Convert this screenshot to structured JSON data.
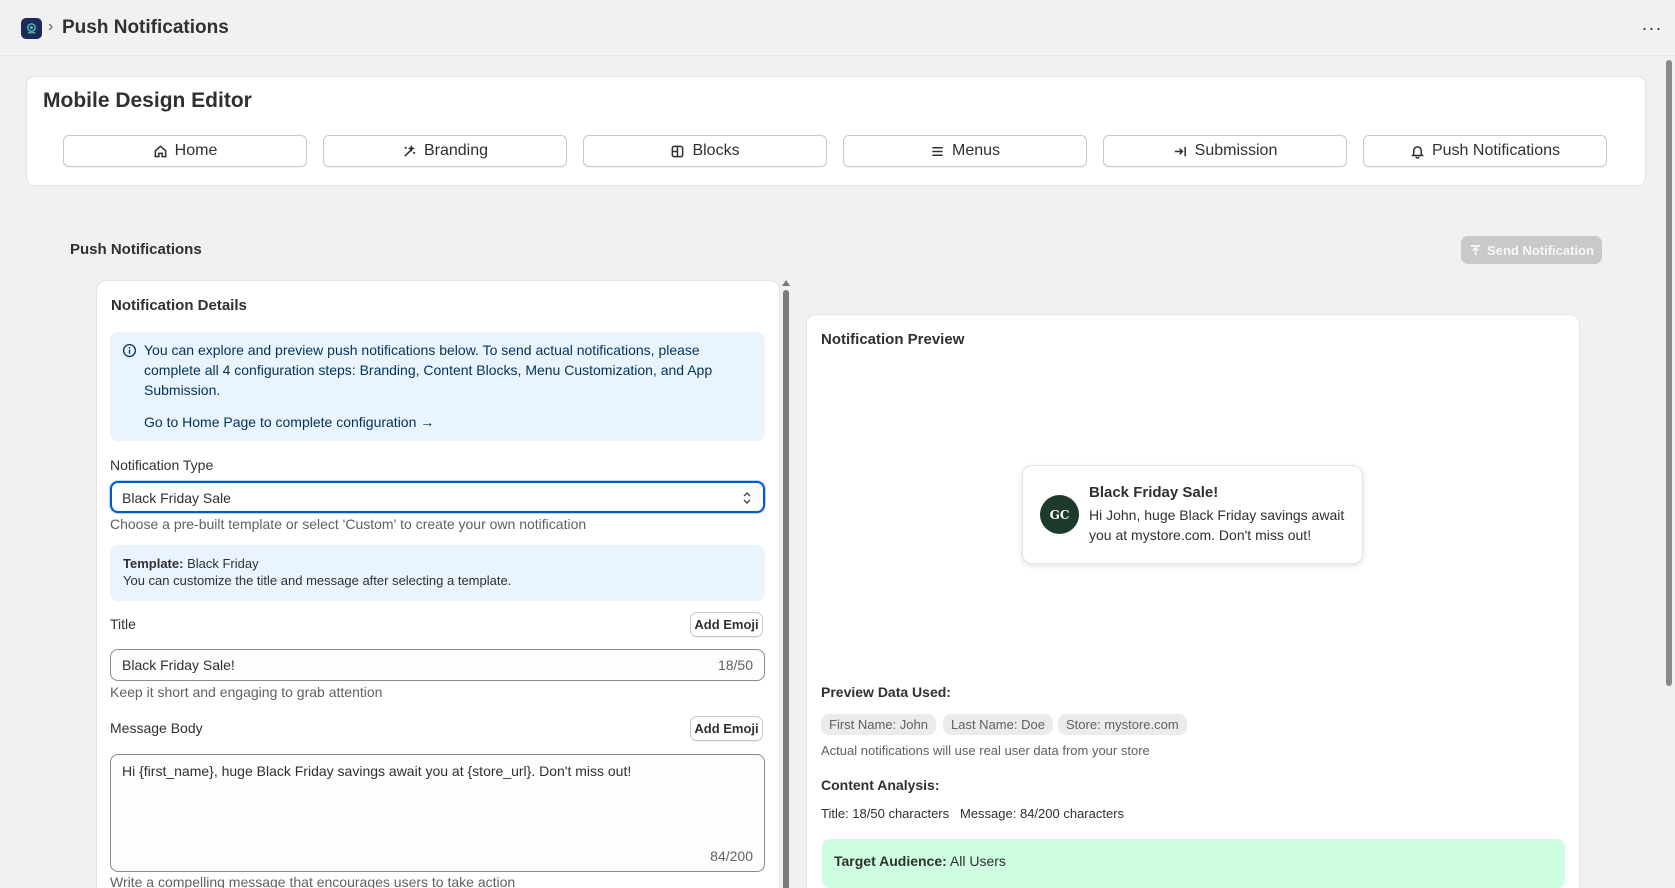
{
  "topbar": {
    "crumb_separator": "›",
    "title": "Push Notifications",
    "more_label": "···"
  },
  "editor": {
    "title": "Mobile Design Editor",
    "tabs": [
      {
        "label": "Home",
        "icon": "home-icon"
      },
      {
        "label": "Branding",
        "icon": "magic-wand-icon"
      },
      {
        "label": "Blocks",
        "icon": "blocks-icon"
      },
      {
        "label": "Menus",
        "icon": "menu-icon"
      },
      {
        "label": "Submission",
        "icon": "arrow-right-to-line-icon"
      },
      {
        "label": "Push Notifications",
        "icon": "bell-icon"
      }
    ]
  },
  "section": {
    "title": "Push Notifications",
    "send_button": "Send Notification"
  },
  "details": {
    "heading": "Notification Details",
    "info_text": "You can explore and preview push notifications below. To send actual notifications, please complete all 4 configuration steps: Branding, Content Blocks, Menu Customization, and App Submission.",
    "info_link": "Go to Home Page to complete configuration →",
    "type_label": "Notification Type",
    "type_value": "Black Friday Sale",
    "type_help": "Choose a pre-built template or select 'Custom' to create your own notification",
    "template_label": "Template:",
    "template_value": "Black Friday",
    "template_note": "You can customize the title and message after selecting a template.",
    "title_label": "Title",
    "add_emoji": "Add Emoji",
    "title_value": "Black Friday Sale!",
    "title_count": "18/50",
    "title_help": "Keep it short and engaging to grab attention",
    "message_label": "Message Body",
    "message_value": "Hi {first_name}, huge Black Friday savings await you at {store_url}. Don't miss out!",
    "message_count": "84/200",
    "message_help": "Write a compelling message that encourages users to take action"
  },
  "preview": {
    "heading": "Notification Preview",
    "avatar_text": "GC",
    "notif_title": "Black Friday Sale!",
    "notif_body": "Hi John, huge Black Friday savings await you at mystore.com. Don't miss out!",
    "data_heading": "Preview Data Used:",
    "chips": [
      "First Name: John",
      "Last Name: Doe",
      "Store: mystore.com"
    ],
    "data_note": "Actual notifications will use real user data from your store",
    "analysis_heading": "Content Analysis:",
    "analysis_title": "Title: 18/50 characters",
    "analysis_message": "Message: 84/200 characters",
    "audience_label": "Target Audience:",
    "audience_value": "All Users"
  },
  "colors": {
    "accent": "#005bd3",
    "info_bg": "#eaf4ff",
    "success_bg": "#cdfee1",
    "disabled_button": "#c9c9c9"
  }
}
